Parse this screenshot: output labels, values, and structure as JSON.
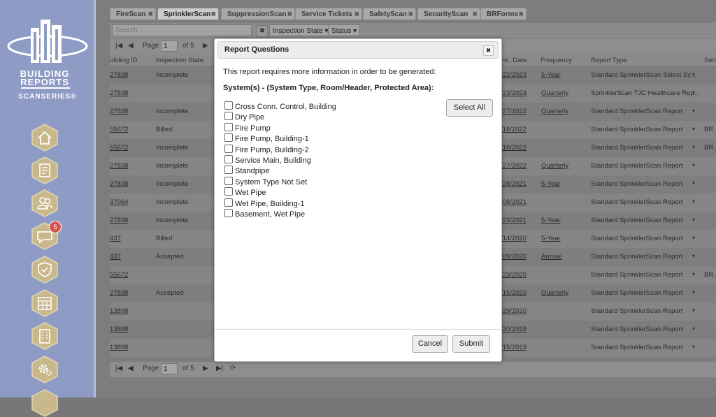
{
  "brand": {
    "line1": "BUILDING",
    "line2": "REPORTS",
    "line3": "SCANSERIES®"
  },
  "nav": {
    "items": [
      {
        "name": "home-icon"
      },
      {
        "name": "report-icon"
      },
      {
        "name": "users-icon"
      },
      {
        "name": "chat-icon",
        "badge": "5"
      },
      {
        "name": "shield-check-icon"
      },
      {
        "name": "calendar-icon"
      },
      {
        "name": "building-icon"
      },
      {
        "name": "settings-icon"
      }
    ]
  },
  "tabs": [
    {
      "label": "FireScan"
    },
    {
      "label": "SprinklerScan",
      "active": true
    },
    {
      "label": "SuppressionScan"
    },
    {
      "label": "Service Tickets"
    },
    {
      "label": "SafetyScan"
    },
    {
      "label": "SecurityScan"
    },
    {
      "label": "BRForms"
    }
  ],
  "toolbar": {
    "search_placeholder": "Search...",
    "clear": "✖",
    "inspection_state": "Inspection State ▾",
    "status": "Status ▾"
  },
  "pager": {
    "page_label": "Page",
    "page_value": "1",
    "of_label": "of 5"
  },
  "grid": {
    "headers": {
      "building_id": "uilding ID",
      "state": "Inspection State",
      "date": "nc. Date",
      "frequency": "Frequency",
      "report_type": "Report Type",
      "sen": "Sen."
    },
    "rows": [
      {
        "id": "27838",
        "state": "Incomplete",
        "date": "/22/2023",
        "freq": "5-Year",
        "type": "Standard SprinklerScan Select Sy...",
        "extra": ""
      },
      {
        "id": "27838",
        "state": "",
        "date": "/23/2023",
        "freq": "Quarterly",
        "type": "SprinklerScan TJC Healthcare Rep...",
        "extra": ""
      },
      {
        "id": "27838",
        "state": "Incomplete",
        "date": "/27/2022",
        "freq": "Quarterly",
        "type": "Standard SprinklerScan Report",
        "extra": ""
      },
      {
        "id": "55672",
        "state": "Billed",
        "date": "/18/2022",
        "freq": "",
        "type": "Standard SprinklerScan Report",
        "extra": "BR..."
      },
      {
        "id": "55672",
        "state": "Incomplete",
        "date": "/18/2022",
        "freq": "",
        "type": "Standard SprinklerScan Report",
        "extra": "BR..."
      },
      {
        "id": "27838",
        "state": "Incomplete",
        "date": "/27/2022",
        "freq": "Quarterly",
        "type": "Standard SprinklerScan Report",
        "extra": ""
      },
      {
        "id": "27838",
        "state": "Incomplete",
        "date": "/28/2021",
        "freq": "5-Year",
        "type": "Standard SprinklerScan Report",
        "extra": ""
      },
      {
        "id": "37064",
        "state": "Incomplete",
        "date": "/08/2021",
        "freq": "",
        "type": "Standard SprinklerScan Report",
        "extra": ""
      },
      {
        "id": "27838",
        "state": "Incomplete",
        "date": "/23/2021",
        "freq": "5-Year",
        "type": "Standard SprinklerScan Report",
        "extra": ""
      },
      {
        "id": "437",
        "state": "Billed",
        "date": "/14/2020",
        "freq": "5-Year",
        "type": "Standard SprinklerScan Report",
        "extra": ""
      },
      {
        "id": "437",
        "state": "Accepted",
        "date": "/09/2020",
        "freq": "Annual",
        "type": "Standard SprinklerScan Report",
        "extra": ""
      },
      {
        "id": "55672",
        "state": "",
        "date": "/23/2020",
        "freq": "",
        "type": "Standard SprinklerScan Report",
        "extra": "BR..."
      },
      {
        "id": "27838",
        "state": "Accepted",
        "date": "/15/2020",
        "freq": "Quarterly",
        "type": "Standard SprinklerScan Report",
        "extra": ""
      },
      {
        "id": "13898",
        "state": "",
        "date": "/29/2020",
        "freq": "",
        "type": "Standard SprinklerScan Report",
        "extra": ""
      },
      {
        "id": "13898",
        "state": "",
        "date": "/20/2019",
        "freq": "",
        "type": "Standard SprinklerScan Report",
        "extra": ""
      },
      {
        "id": "13898",
        "state": "",
        "date": "/15/2019",
        "freq": "",
        "type": "Standard SprinklerScan Report",
        "extra": ""
      }
    ]
  },
  "modal": {
    "title": "Report Questions",
    "close": "✖",
    "message": "This report requires more information in order to be generated:",
    "section": "System(s) - (System Type, Room/Header, Protected Area):",
    "options": [
      "Cross Conn. Control, Building",
      "Dry Pipe",
      "Fire Pump",
      "Fire Pump, Building-1",
      "Fire Pump, Building-2",
      "Service Main, Building",
      "Standpipe",
      "System Type Not Set",
      "Wet Pipe",
      "Wet Pipe, Building-1",
      "Basement, Wet Pipe"
    ],
    "select_all": "Select All",
    "cancel": "Cancel",
    "submit": "Submit"
  },
  "colors": {
    "sidebar": "#8e9bc4",
    "hex_fill": "#c8b88c",
    "badge": "#d9534f"
  }
}
